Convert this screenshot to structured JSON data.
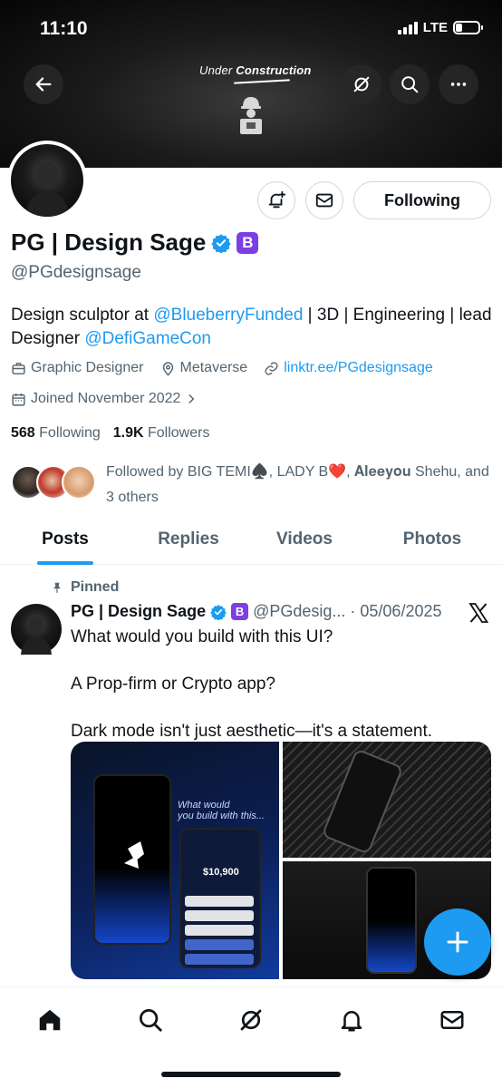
{
  "status": {
    "time": "11:10",
    "network": "LTE",
    "battery_level": 0.3
  },
  "banner": {
    "text_prefix": "Under",
    "text_bold": "Construction"
  },
  "profile": {
    "name": "PG | Design Sage",
    "badge_letter": "B",
    "handle": "@PGdesignsage",
    "following_label": "Following",
    "bio": {
      "part1": "Design sculptor at ",
      "link1": "@BlueberryFunded",
      "part2": " | 3D | Engineering | lead Designer ",
      "link2": "@DefiGameCon"
    },
    "category": "Graphic Designer",
    "location": "Metaverse",
    "website": "linktr.ee/PGdesignsage",
    "joined": "Joined November 2022",
    "following_count": "568",
    "following_text": "Following",
    "followers_count": "1.9K",
    "followers_text": "Followers",
    "followed_by": "Followed by BIG TEMI♠️, LADY B❤️, 𝐀𝐥𝐞𝐞𝐲𝐨𝐮 Shehu, and 3 others"
  },
  "tabs": [
    "Posts",
    "Replies",
    "Videos",
    "Photos"
  ],
  "tweet": {
    "pinned_label": "Pinned",
    "name": "PG | Design Sage",
    "badge_letter": "B",
    "handle_date": "@PGdesig... · 05/06/2025",
    "text": [
      "What would you build with this UI?",
      "A Prop-firm or Crypto app?",
      "Dark mode isn't just aesthetic—it's a statement."
    ],
    "media": {
      "caption_line1": "What would",
      "caption_line2": "you build with this...",
      "balance": "$10,900"
    }
  },
  "nav": [
    "home-icon",
    "search-icon",
    "grok-icon",
    "bell-icon",
    "mail-icon"
  ],
  "colors": {
    "accent": "#1d9bf0",
    "badge": "#7b3fe4",
    "text": "#0f1419",
    "muted": "#536471"
  }
}
